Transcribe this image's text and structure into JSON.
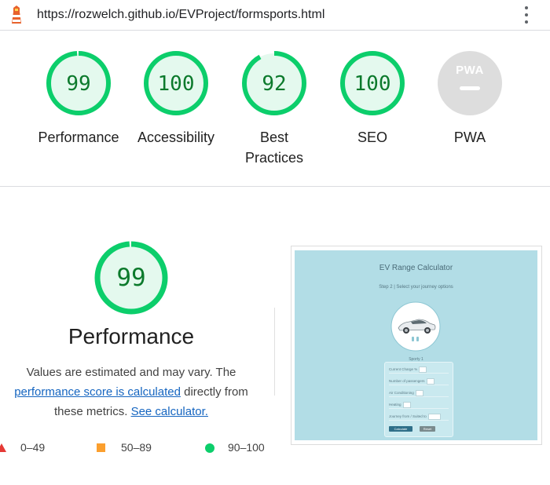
{
  "browser": {
    "url": "https://rozwelch.github.io/EVProject/formsports.html",
    "menu_icon": "kebab-menu-icon",
    "site_icon": "lighthouse-icon"
  },
  "summary_scores": [
    {
      "label": "Performance",
      "value": "99",
      "score": 99
    },
    {
      "label": "Accessibility",
      "value": "100",
      "score": 100
    },
    {
      "label": "Best Practices",
      "value": "92",
      "score": 92
    },
    {
      "label": "SEO",
      "value": "100",
      "score": 100
    },
    {
      "label": "PWA",
      "value": "PWA",
      "score": null
    }
  ],
  "colors": {
    "pass": "#0cce6b",
    "pass_text": "#0c7a2c",
    "average": "#fb9f2e",
    "fail": "#e53935",
    "link": "#1565c0",
    "na": "#dddddd"
  },
  "performance": {
    "score": "99",
    "score_value": 99,
    "title": "Performance",
    "desc_part1": "Values are estimated and may vary. The",
    "desc_link1": "performance score is calculated",
    "desc_part2": "directly from these metrics.",
    "desc_link2": "See calculator."
  },
  "legend": [
    {
      "range": "0–49",
      "shape": "triangle"
    },
    {
      "range": "50–89",
      "shape": "square"
    },
    {
      "range": "90–100",
      "shape": "circle"
    }
  ],
  "screenshot": {
    "title": "EV Range Calculator",
    "step": "Step 2 | Select your journey options",
    "car_caption": "Sporty 1",
    "fields": [
      "Current Charge %",
      "Number of passengers",
      "Air Conditioning",
      "Heating",
      "Journey from / Suited to"
    ],
    "calculate_label": "Calculate",
    "reset_label": "Reset"
  }
}
